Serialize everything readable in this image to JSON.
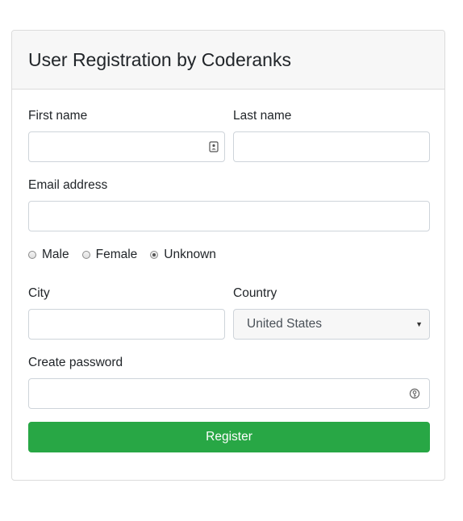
{
  "header": {
    "title": "User Registration by Coderanks"
  },
  "form": {
    "first_name": {
      "label": "First name",
      "value": "",
      "icon": "contact-card-icon"
    },
    "last_name": {
      "label": "Last name",
      "value": ""
    },
    "email": {
      "label": "Email address",
      "value": ""
    },
    "gender": {
      "options": [
        "Male",
        "Female",
        "Unknown"
      ],
      "selected": "Unknown"
    },
    "city": {
      "label": "City",
      "value": ""
    },
    "country": {
      "label": "Country",
      "selected": "United States"
    },
    "password": {
      "label": "Create password",
      "value": "",
      "icon": "password-key-icon"
    },
    "submit_label": "Register"
  },
  "colors": {
    "primary_button": "#28a745",
    "header_bg": "#f7f7f7",
    "border": "#dcdcdc"
  }
}
